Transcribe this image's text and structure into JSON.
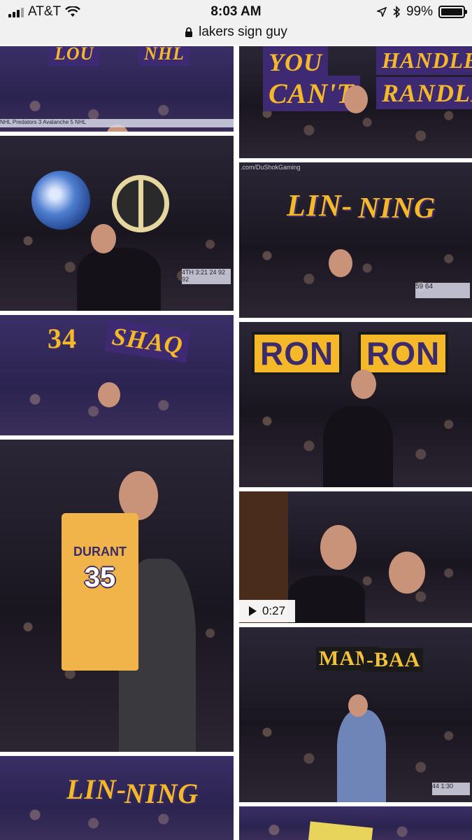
{
  "status_bar": {
    "carrier": "AT&T",
    "time": "8:03 AM",
    "battery": "99%",
    "battery_level": 0.99,
    "icons": [
      "signal-icon",
      "wifi-icon",
      "location-icon",
      "bluetooth-icon",
      "battery-icon"
    ]
  },
  "address_bar": {
    "query": "lakers sign guy",
    "icon": "lock-icon"
  },
  "results": [
    {
      "id": "r1",
      "sign_text": [
        "LOU",
        "NHL"
      ],
      "ticker": "NHL  Predators 3  Avalanche 5  NHL"
    },
    {
      "id": "r2",
      "sign_text": [
        "YOU",
        "CAN'T",
        "HANDLE",
        "RANDLE"
      ]
    },
    {
      "id": "r3",
      "sign_text": [],
      "score": "4TH  3:21  24  92 92",
      "icons": [
        "globe-sign",
        "peace-sign"
      ]
    },
    {
      "id": "r4",
      "sign_text": [
        "LIN-",
        "NING"
      ],
      "watermark": ".com/DuShokGaming",
      "score": "59  64"
    },
    {
      "id": "r5",
      "sign_text": [
        "34",
        "SHAQ"
      ]
    },
    {
      "id": "r6",
      "sign_text": [
        "RON",
        "RON"
      ]
    },
    {
      "id": "r7",
      "jersey_name": "DURANT",
      "jersey_number": "35"
    },
    {
      "id": "r8",
      "video_duration": "0:27"
    },
    {
      "id": "r9",
      "sign_text": [
        "MAM",
        "-BAA"
      ],
      "score": "44  1:30"
    },
    {
      "id": "r10",
      "sign_text": [
        "LIN-",
        "NING"
      ]
    },
    {
      "id": "r11",
      "sign_text": []
    }
  ]
}
